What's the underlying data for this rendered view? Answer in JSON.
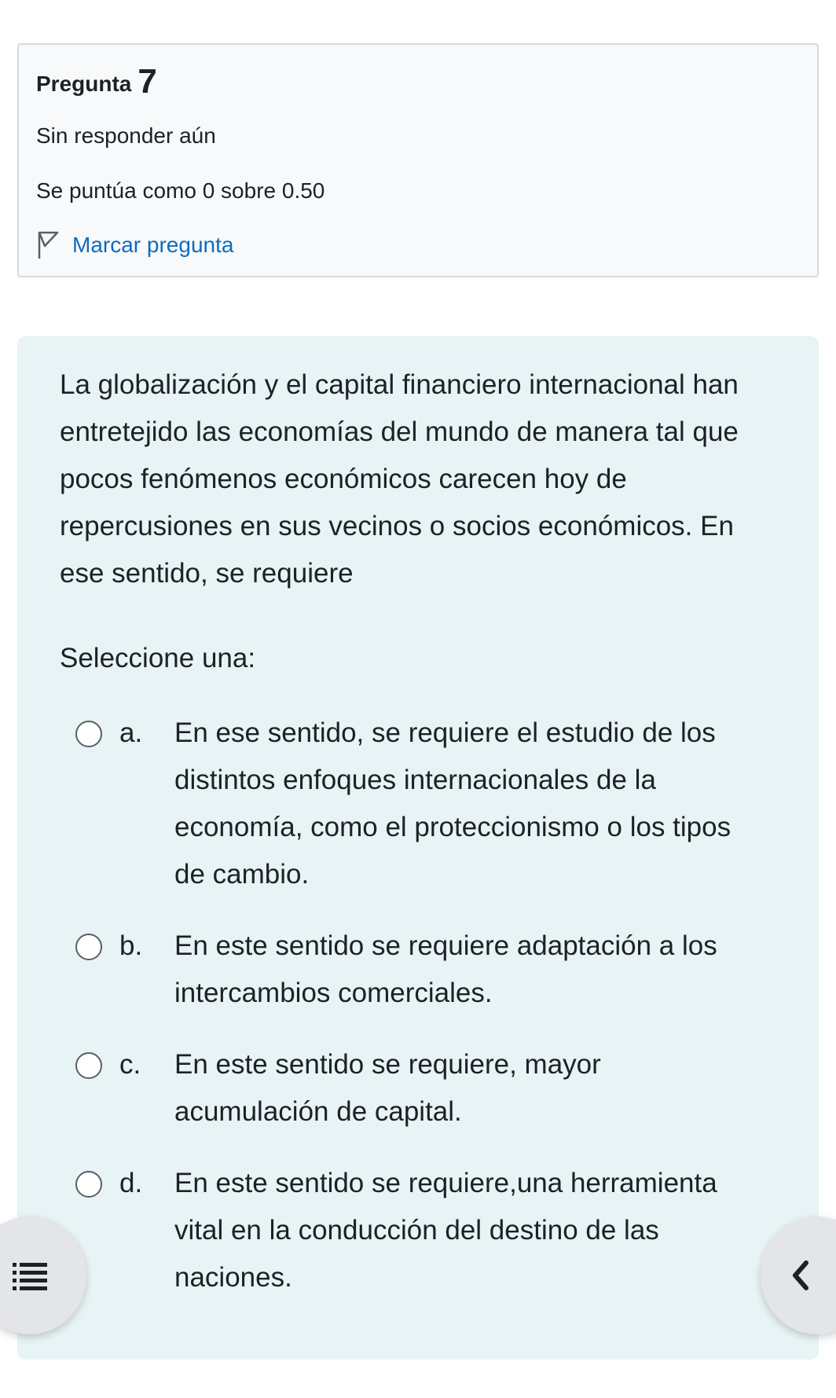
{
  "info": {
    "title_label": "Pregunta",
    "number": "7",
    "state": "Sin responder aún",
    "grade": "Se puntúa como 0 sobre 0.50",
    "flag_label": "Marcar pregunta"
  },
  "question": {
    "text": "La globalización y el capital financiero internacional han entretejido las economías del mundo de manera tal que pocos fenómenos económicos carecen hoy de repercusiones en sus vecinos o socios económicos. En ese sentido, se requiere",
    "prompt": "Seleccione una:",
    "answers": [
      {
        "letter": "a.",
        "text": "En ese sentido, se requiere el estudio de los distintos enfoques internacionales de la economía, como el proteccionismo o los tipos de cambio.",
        "selected": false
      },
      {
        "letter": "b.",
        "text": "En este sentido se requiere adaptación  a los intercambios comerciales.",
        "selected": false
      },
      {
        "letter": "c.",
        "text": "En este sentido se requiere, mayor acumulación de capital.",
        "selected": false
      },
      {
        "letter": "d.",
        "text": "En este sentido se requiere,una herramienta vital en la conducción del destino de las naciones.",
        "selected": false
      }
    ]
  },
  "buttons": {
    "left_icon": "list-icon",
    "right_icon": "chevron-left-icon"
  }
}
